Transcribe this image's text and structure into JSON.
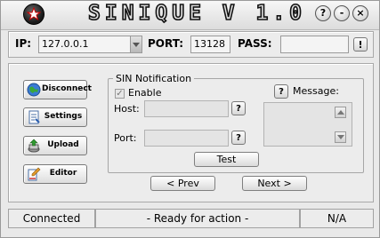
{
  "title": "SINIQUE V 1.0",
  "window_buttons": {
    "help": "?",
    "minimize": "-",
    "close": "×"
  },
  "connection": {
    "ip_label": "IP:",
    "ip_value": "127.0.0.1",
    "port_label": "PORT:",
    "port_value": "13128",
    "pass_label": "PASS:",
    "pass_value": "",
    "pass_help": "!"
  },
  "sidebar": {
    "items": [
      {
        "label": "Disconnect",
        "icon": "globe-icon"
      },
      {
        "label": "Settings",
        "icon": "document-icon"
      },
      {
        "label": "Upload",
        "icon": "upload-icon"
      },
      {
        "label": "Editor",
        "icon": "editor-icon"
      }
    ]
  },
  "sin": {
    "legend": "SIN Notification",
    "enable_label": "Enable",
    "enable_checked": true,
    "host_label": "Host:",
    "host_value": "",
    "port_label": "Port:",
    "port_value": "",
    "help": "?",
    "message_label": "Message:",
    "message_value": "",
    "test_label": "Test"
  },
  "nav": {
    "prev_label": "< Prev",
    "next_label": "Next >"
  },
  "status": {
    "connection": "Connected",
    "message": "- Ready for action -",
    "extra": "N/A"
  }
}
